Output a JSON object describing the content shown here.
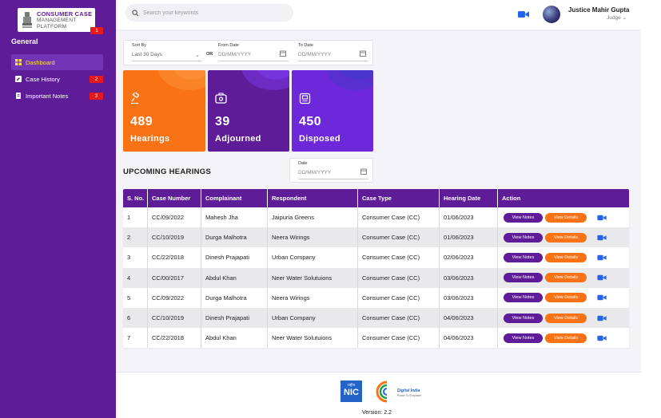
{
  "app": {
    "logo_line1": "CONSUMER CASE",
    "logo_line2": "MANAGEMENT",
    "logo_line3": "PLATFORM",
    "logo_badge": "1"
  },
  "sidebar": {
    "section_title": "General",
    "items": [
      {
        "label": "Dashboard",
        "badge": "",
        "active": true
      },
      {
        "label": "Case History",
        "badge": "2"
      },
      {
        "label": "Important Notes",
        "badge": "3"
      }
    ]
  },
  "topbar": {
    "search_placeholder": "Search your keywords",
    "user_name": "Justice Mahir Gupta",
    "user_role": "Judge"
  },
  "filters": {
    "sort_label": "Sort By",
    "sort_value": "Last 30 Days",
    "or_label": "OR",
    "from_label": "From Date",
    "from_placeholder": "DD/MM/YYYY",
    "to_label": "To Date",
    "to_placeholder": "DD/MM/YYYY"
  },
  "stats": [
    {
      "value": "489",
      "label": "Hearings",
      "color": "#f97316",
      "deco": "#fb923c"
    },
    {
      "value": "39",
      "label": "Adjourned",
      "color": "#5e1c98",
      "deco": "#7c3aed"
    },
    {
      "value": "450",
      "label": "Disposed",
      "color": "#6d28d9",
      "deco": "#4338ca"
    }
  ],
  "upcoming": {
    "title": "UPCOMING HEARINGS",
    "date_label": "Date",
    "date_placeholder": "DD/MM/YYYY"
  },
  "table": {
    "headers": [
      "S. No.",
      "Case Number",
      "Complainant",
      "Respondent",
      "Case Type",
      "Hearing Date",
      "Action"
    ],
    "view_notes_label": "View Notes",
    "view_details_label": "View Details",
    "rows": [
      [
        "1",
        "CC/09/2022",
        "Mahesh Jha",
        "Jaipuria Greens",
        "Consumer Case (CC)",
        "01/06/2023"
      ],
      [
        "2",
        "CC/10/2019",
        "Durga Malhotra",
        "Neera Wirings",
        "Consumer Case (CC)",
        "01/06/2023"
      ],
      [
        "3",
        "CC/22/2018",
        "Dinesh Prajapati",
        "Urban Company",
        "Consumer Case (CC)",
        "02/06/2023"
      ],
      [
        "4",
        "CC/00/2017",
        "Abdul Khan",
        "Neer Water Solutuions",
        "Consumer Case (CC)",
        "03/06/2023"
      ],
      [
        "5",
        "CC/09/2022",
        "Durga Malhotra",
        "Neera Wirings",
        "Consumer Case (CC)",
        "03/06/2023"
      ],
      [
        "6",
        "CC/10/2019",
        "Dinesh Prajapati",
        "Urban Company",
        "Consumer Case (CC)",
        "04/06/2023"
      ],
      [
        "7",
        "CC/22/2018",
        "Abdul Khan",
        "Neer Water Solutuions",
        "Consumer Case (CC)",
        "04/06/2023"
      ]
    ]
  },
  "footer": {
    "nic_hindi": "राष्ट्रीय",
    "nic": "NIC",
    "digital_india": "Digital India",
    "digital_india_sub": "Power To Empower",
    "version": "Version: 2.2"
  },
  "colors": {
    "primary": "#5e1c98",
    "accent": "#f97316",
    "badge": "#e51b1b",
    "active_text": "#fde047"
  }
}
